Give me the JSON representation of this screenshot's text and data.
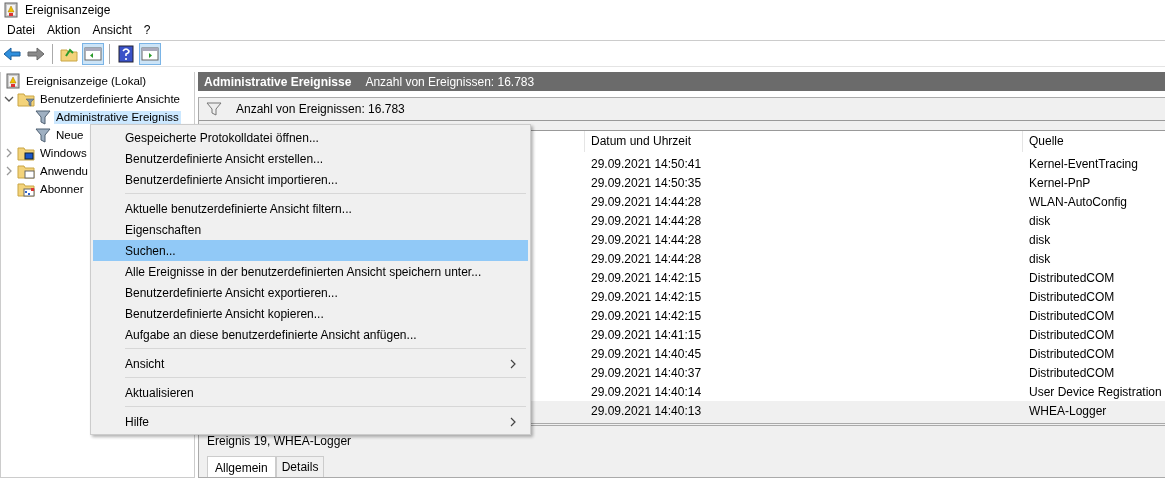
{
  "window": {
    "title": "Ereignisanzeige"
  },
  "menu_bar": [
    "Datei",
    "Aktion",
    "Ansicht",
    "?"
  ],
  "toolbar": [
    {
      "kind": "back",
      "on": false
    },
    {
      "kind": "forward",
      "on": false
    },
    {
      "kind": "separator"
    },
    {
      "kind": "up",
      "on": false
    },
    {
      "kind": "tree-pane",
      "on": true
    },
    {
      "kind": "separator"
    },
    {
      "kind": "help",
      "on": false
    },
    {
      "kind": "action-pane",
      "on": true
    }
  ],
  "tree": [
    {
      "label": "Ereignisanzeige (Lokal)",
      "kind": "log",
      "selected": false,
      "children": [
        {
          "label": "Benutzerdefinierte Ansichte",
          "kind": "folder-filter",
          "expanded": true,
          "selected": false,
          "children": [
            {
              "label": "Administrative Ereigniss",
              "kind": "filter",
              "selected": true
            },
            {
              "label": "Neue",
              "kind": "filter",
              "selected": false
            }
          ]
        },
        {
          "label": "Windows",
          "kind": "folder-windows",
          "expanded": false,
          "selected": false
        },
        {
          "label": "Anwendu",
          "kind": "folder-app",
          "expanded": false,
          "selected": false
        },
        {
          "label": "Abonner",
          "kind": "subscriptions",
          "selected": false
        }
      ]
    }
  ],
  "header": {
    "title": "Administrative Ereignisse",
    "count": "Anzahl von Ereignissen: 16.783"
  },
  "filter_bar": {
    "text": "Anzahl von Ereignissen: 16.783"
  },
  "table": {
    "columns": [
      "Datum und Uhrzeit",
      "Quelle"
    ],
    "rows": [
      {
        "date": "29.09.2021 14:50:41",
        "source": "Kernel-EventTracing",
        "selected": false
      },
      {
        "date": "29.09.2021 14:50:35",
        "source": "Kernel-PnP",
        "selected": false
      },
      {
        "date": "29.09.2021 14:44:28",
        "source": "WLAN-AutoConfig",
        "selected": false
      },
      {
        "date": "29.09.2021 14:44:28",
        "source": "disk",
        "selected": false
      },
      {
        "date": "29.09.2021 14:44:28",
        "source": "disk",
        "selected": false
      },
      {
        "date": "29.09.2021 14:44:28",
        "source": "disk",
        "selected": false
      },
      {
        "date": "29.09.2021 14:42:15",
        "source": "DistributedCOM",
        "selected": false
      },
      {
        "date": "29.09.2021 14:42:15",
        "source": "DistributedCOM",
        "selected": false
      },
      {
        "date": "29.09.2021 14:42:15",
        "source": "DistributedCOM",
        "selected": false
      },
      {
        "date": "29.09.2021 14:41:15",
        "source": "DistributedCOM",
        "selected": false
      },
      {
        "date": "29.09.2021 14:40:45",
        "source": "DistributedCOM",
        "selected": false
      },
      {
        "date": "29.09.2021 14:40:37",
        "source": "DistributedCOM",
        "selected": false
      },
      {
        "date": "29.09.2021 14:40:14",
        "source": "User Device Registration",
        "selected": false
      },
      {
        "date": "29.09.2021 14:40:13",
        "source": "WHEA-Logger",
        "selected": true
      }
    ]
  },
  "preview": {
    "title": "Ereignis 19, WHEA-Logger",
    "tabs": [
      {
        "label": "Allgemein",
        "selected": true
      },
      {
        "label": "Details",
        "selected": false
      }
    ]
  },
  "context_menu": [
    {
      "kind": "item",
      "label": "Gespeicherte Protokolldatei öffnen...",
      "selected": false,
      "submenu": false
    },
    {
      "kind": "item",
      "label": "Benutzerdefinierte Ansicht erstellen...",
      "selected": false,
      "submenu": false
    },
    {
      "kind": "item",
      "label": "Benutzerdefinierte Ansicht importieren...",
      "selected": false,
      "submenu": false
    },
    {
      "kind": "separator"
    },
    {
      "kind": "item",
      "label": "Aktuelle benutzerdefinierte Ansicht filtern...",
      "selected": false,
      "submenu": false
    },
    {
      "kind": "item",
      "label": "Eigenschaften",
      "selected": false,
      "submenu": false
    },
    {
      "kind": "item",
      "label": "Suchen...",
      "selected": true,
      "submenu": false
    },
    {
      "kind": "item",
      "label": "Alle Ereignisse in der benutzerdefinierten Ansicht speichern unter...",
      "selected": false,
      "submenu": false
    },
    {
      "kind": "item",
      "label": "Benutzerdefinierte Ansicht exportieren...",
      "selected": false,
      "submenu": false
    },
    {
      "kind": "item",
      "label": "Benutzerdefinierte Ansicht kopieren...",
      "selected": false,
      "submenu": false
    },
    {
      "kind": "item",
      "label": "Aufgabe an diese benutzerdefinierte Ansicht anfügen...",
      "selected": false,
      "submenu": false
    },
    {
      "kind": "separator"
    },
    {
      "kind": "item",
      "label": "Ansicht",
      "selected": false,
      "submenu": true
    },
    {
      "kind": "separator"
    },
    {
      "kind": "item",
      "label": "Aktualisieren",
      "selected": false,
      "submenu": false
    },
    {
      "kind": "separator"
    },
    {
      "kind": "item",
      "label": "Hilfe",
      "selected": false,
      "submenu": true
    }
  ]
}
